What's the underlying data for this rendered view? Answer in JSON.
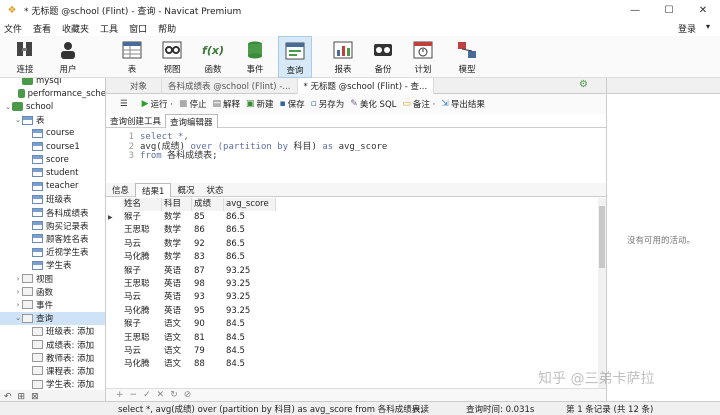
{
  "window": {
    "title": "* 无标题 @school (Flint) - 查询 - Navicat Premium",
    "minimize": "—",
    "maximize": "☐",
    "close": "✕"
  },
  "menu": {
    "items": [
      "文件",
      "查看",
      "收藏夹",
      "工具",
      "窗口",
      "帮助"
    ],
    "login": "登录"
  },
  "toolbar": {
    "items": [
      {
        "label": "连接",
        "icon": "connection-icon"
      },
      {
        "label": "用户",
        "icon": "user-icon"
      },
      {
        "label": "表",
        "icon": "table-icon"
      },
      {
        "label": "视图",
        "icon": "view-icon"
      },
      {
        "label": "函数",
        "icon": "function-icon",
        "glyph": "f(x)"
      },
      {
        "label": "事件",
        "icon": "event-icon"
      },
      {
        "label": "查询",
        "icon": "query-icon",
        "active": true
      },
      {
        "label": "报表",
        "icon": "report-icon"
      },
      {
        "label": "备份",
        "icon": "backup-icon"
      },
      {
        "label": "计划",
        "icon": "schedule-icon"
      },
      {
        "label": "模型",
        "icon": "model-icon"
      }
    ]
  },
  "tree": {
    "nodes": [
      {
        "label": "mysql",
        "level": 1,
        "type": "db"
      },
      {
        "label": "performance_sche",
        "level": 1,
        "type": "db"
      },
      {
        "label": "school",
        "level": 0,
        "type": "db",
        "twisty": "⌄"
      },
      {
        "label": "表",
        "level": 1,
        "type": "folder",
        "twisty": "⌄"
      },
      {
        "label": "course",
        "level": 2,
        "type": "table"
      },
      {
        "label": "course1",
        "level": 2,
        "type": "table"
      },
      {
        "label": "score",
        "level": 2,
        "type": "table"
      },
      {
        "label": "student",
        "level": 2,
        "type": "table"
      },
      {
        "label": "teacher",
        "level": 2,
        "type": "table"
      },
      {
        "label": "班级表",
        "level": 2,
        "type": "table"
      },
      {
        "label": "各科成绩表",
        "level": 2,
        "type": "table"
      },
      {
        "label": "购买记录表",
        "level": 2,
        "type": "table"
      },
      {
        "label": "顾客姓名表",
        "level": 2,
        "type": "table"
      },
      {
        "label": "近视学生表",
        "level": 2,
        "type": "table"
      },
      {
        "label": "学生表",
        "level": 2,
        "type": "table"
      },
      {
        "label": "视图",
        "level": 1,
        "type": "view",
        "twisty": "›"
      },
      {
        "label": "函数",
        "level": 1,
        "type": "func",
        "twisty": "›"
      },
      {
        "label": "事件",
        "level": 1,
        "type": "event",
        "twisty": "›"
      },
      {
        "label": "查询",
        "level": 1,
        "type": "query",
        "twisty": "⌄",
        "selected": true
      },
      {
        "label": "班级表: 添加",
        "level": 2,
        "type": "query"
      },
      {
        "label": "成绩表: 添加",
        "level": 2,
        "type": "query"
      },
      {
        "label": "教师表: 添加",
        "level": 2,
        "type": "query"
      },
      {
        "label": "课程表: 添加",
        "level": 2,
        "type": "query"
      },
      {
        "label": "学生表: 添加",
        "level": 2,
        "type": "query"
      }
    ],
    "bottom": [
      "↶",
      "⊞",
      "⊠"
    ]
  },
  "tabs": [
    {
      "label": "对象",
      "active": false
    },
    {
      "label": "各科成绩表 @school (Flint) -...",
      "active": false
    },
    {
      "label": "* 无标题 @school (Flint) - 查...",
      "active": true
    }
  ],
  "query_toolbar": [
    {
      "label": "运行 ·",
      "glyph": "▶",
      "color": "#2aa02a"
    },
    {
      "label": "停止",
      "glyph": "■",
      "color": "#aaaaaa"
    },
    {
      "label": "解释",
      "glyph": "▤",
      "color": "#6a6a6a"
    },
    {
      "label": "新建",
      "glyph": "▣",
      "color": "#3a8a3a"
    },
    {
      "label": "保存",
      "glyph": "▪",
      "color": "#3060a0"
    },
    {
      "label": "另存为",
      "glyph": "▫",
      "color": "#3060a0"
    },
    {
      "label": "美化 SQL",
      "glyph": "✎",
      "color": "#7a5a9a"
    },
    {
      "label": "备注 ·",
      "glyph": "▭",
      "color": "#d0a020"
    },
    {
      "label": "导出结果",
      "glyph": "⇲",
      "color": "#3080c0"
    }
  ],
  "query_subtabs": [
    "查询创建工具",
    "查询编辑器"
  ],
  "editor": {
    "lines": [
      {
        "n": "1",
        "segs": [
          {
            "t": "select *,",
            "k": true
          }
        ]
      },
      {
        "n": "2",
        "segs": [
          {
            "t": "avg(成绩) "
          },
          {
            "t": "over (partition by ",
            "k": true
          },
          {
            "t": "科目) "
          },
          {
            "t": "as",
            "k": true
          },
          {
            "t": " avg_score"
          }
        ]
      },
      {
        "n": "3",
        "segs": [
          {
            "t": "from",
            "k": true
          },
          {
            "t": " 各科成绩表;"
          }
        ]
      }
    ]
  },
  "result_tabs": [
    "信息",
    "结果1",
    "概况",
    "状态"
  ],
  "grid": {
    "columns": [
      "姓名",
      "科目",
      "成绩",
      "avg_score"
    ],
    "rows": [
      [
        "猴子",
        "数学",
        "85",
        "86.5"
      ],
      [
        "王思聪",
        "数学",
        "86",
        "86.5"
      ],
      [
        "马云",
        "数学",
        "92",
        "86.5"
      ],
      [
        "马化腾",
        "数学",
        "83",
        "86.5"
      ],
      [
        "猴子",
        "英语",
        "87",
        "93.25"
      ],
      [
        "王思聪",
        "英语",
        "98",
        "93.25"
      ],
      [
        "马云",
        "英语",
        "93",
        "93.25"
      ],
      [
        "马化腾",
        "英语",
        "95",
        "93.25"
      ],
      [
        "猴子",
        "语文",
        "90",
        "84.5"
      ],
      [
        "王思聪",
        "语文",
        "81",
        "84.5"
      ],
      [
        "马云",
        "语文",
        "79",
        "84.5"
      ],
      [
        "马化腾",
        "语文",
        "88",
        "84.5"
      ]
    ],
    "bottom": [
      "+",
      "−",
      "✓",
      "✕",
      "↻",
      "⊘"
    ]
  },
  "info_panel": {
    "message": "没有可用的活动。"
  },
  "status": {
    "sql": "select *, avg(成绩) over (partition by 科目) as avg_score from 各科成绩表;",
    "mode": "只读",
    "time": "查询时间: 0.031s",
    "records": "第 1 条记录 (共 12 条)"
  },
  "watermark": "知乎 @三弟卡萨拉"
}
